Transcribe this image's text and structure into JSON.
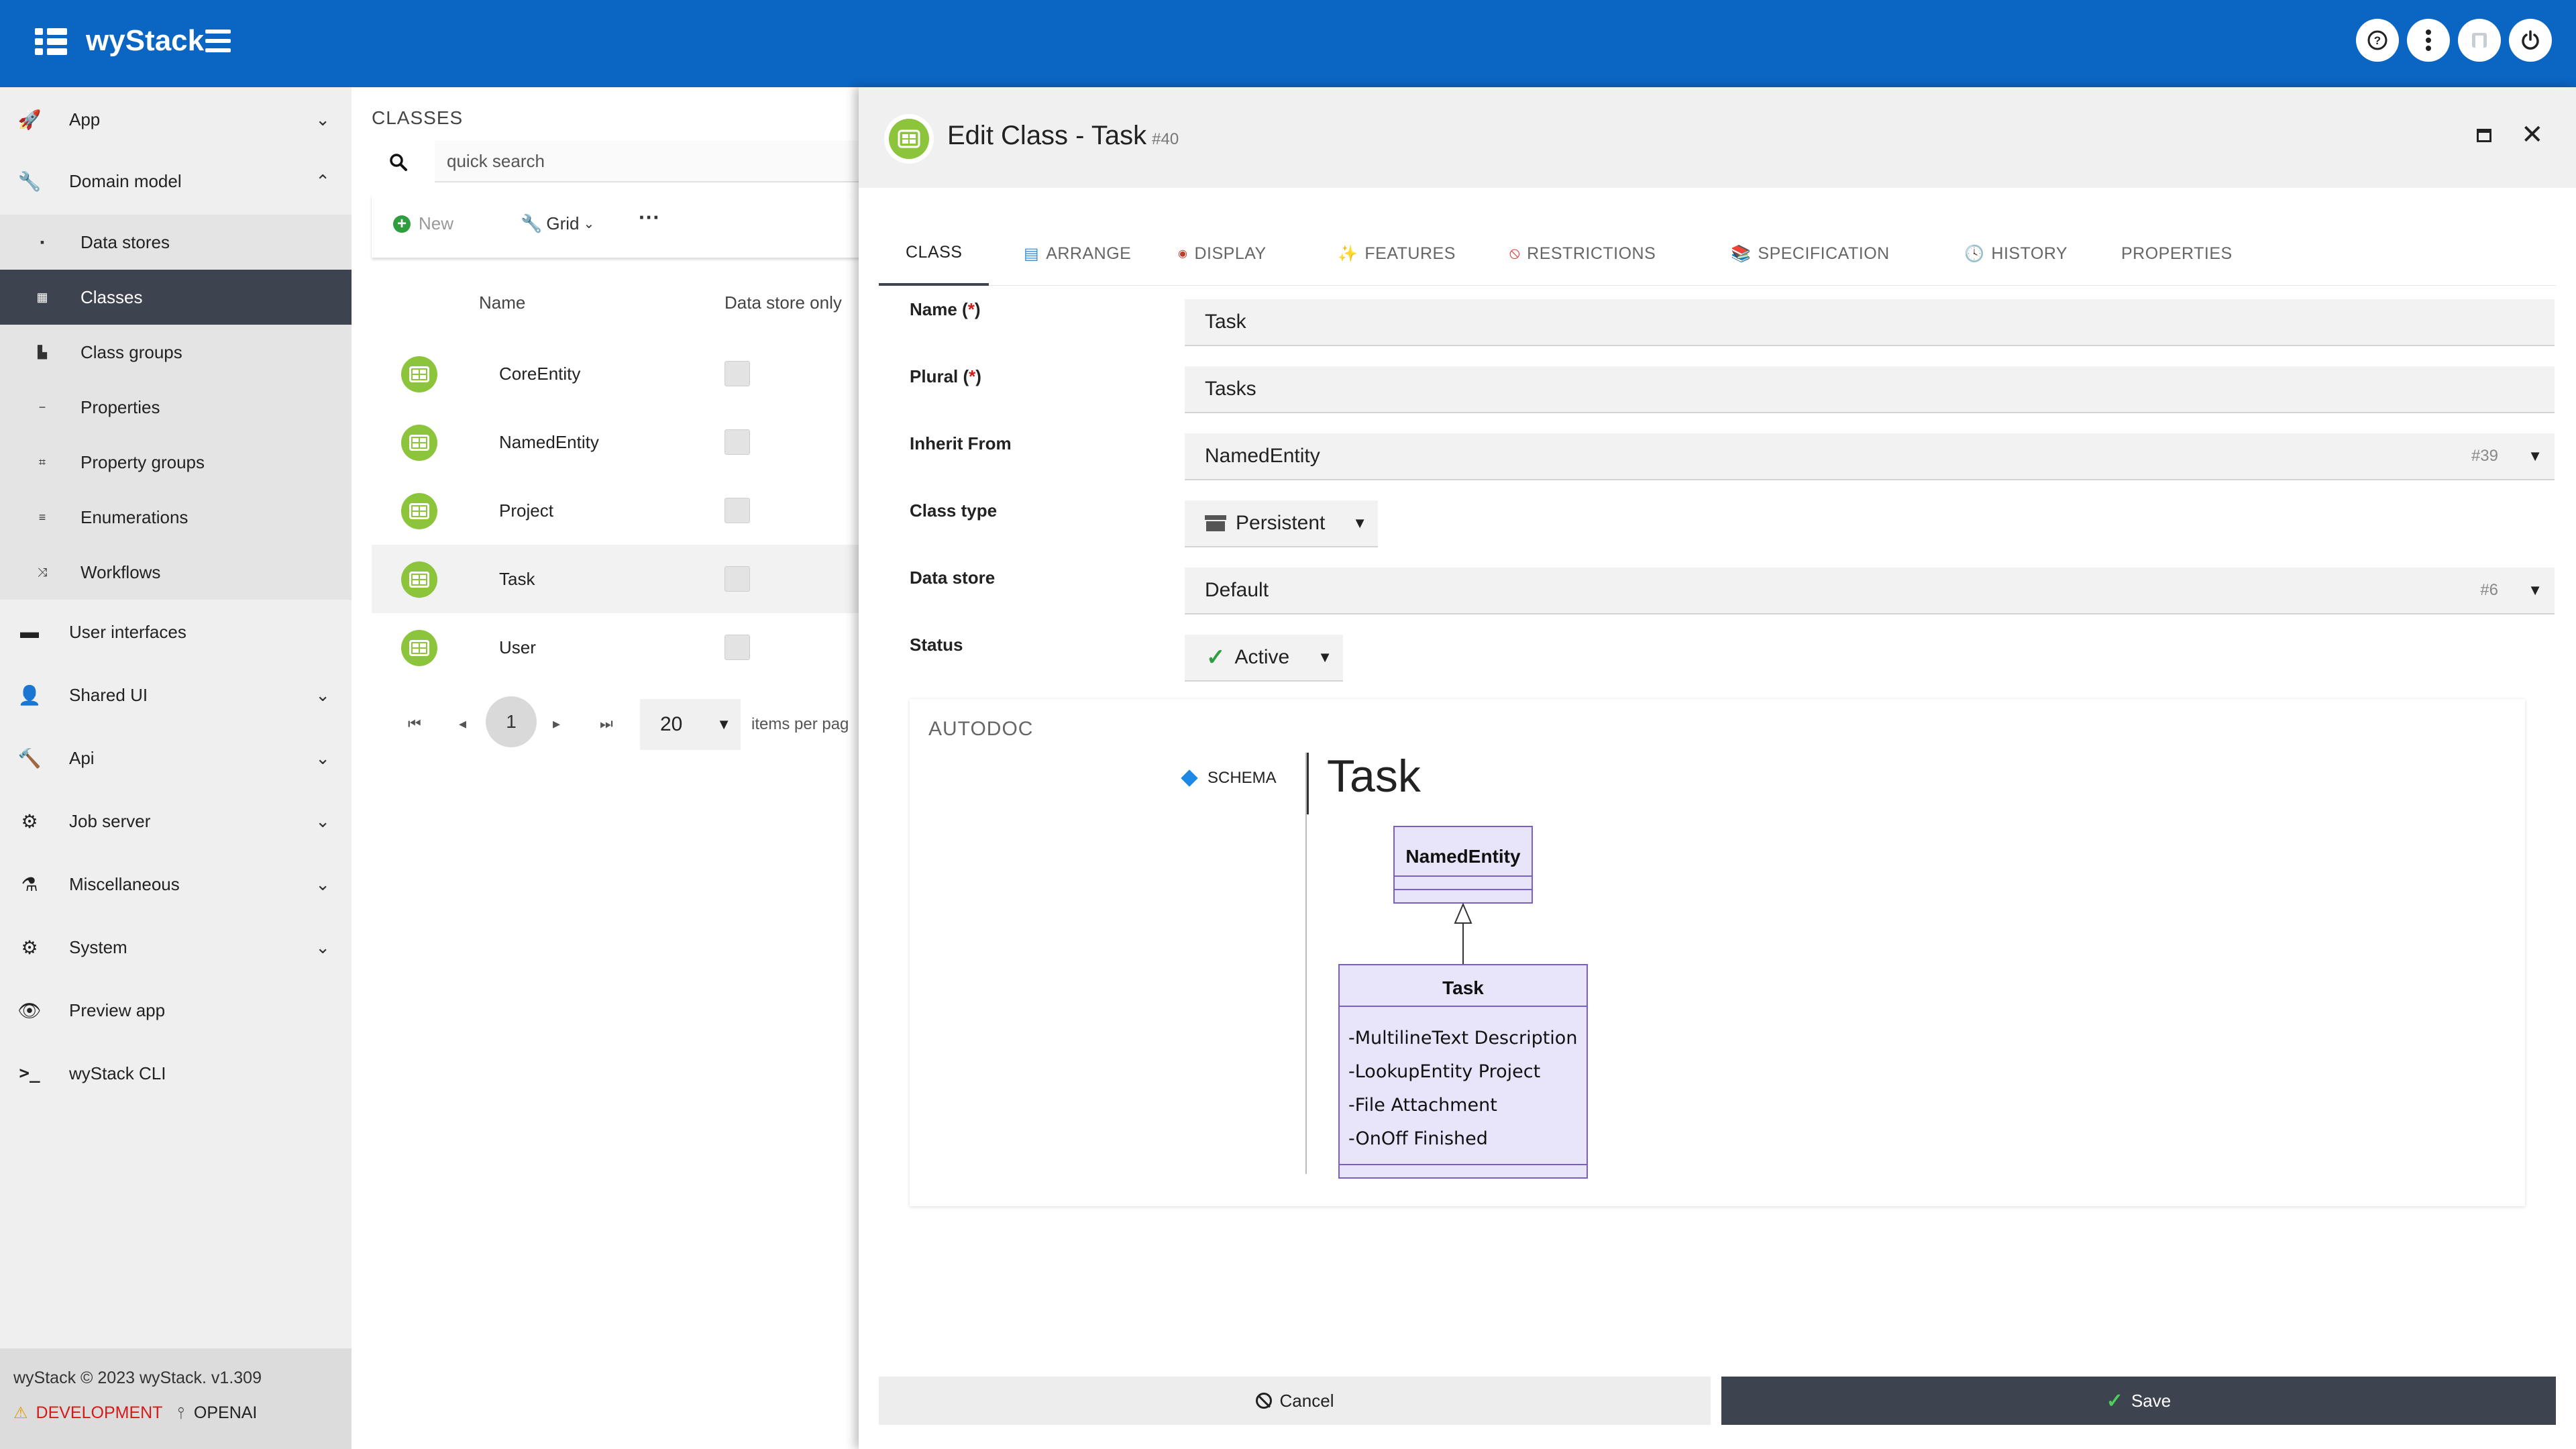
{
  "app": {
    "brand": "wyStack"
  },
  "topbar": {
    "buttons": [
      "help-icon",
      "more-vert-icon",
      "user-icon",
      "power-icon"
    ]
  },
  "sidebar": {
    "items": [
      {
        "label": "App",
        "icon": "rocket-icon",
        "expanded": false
      },
      {
        "label": "Domain model",
        "icon": "wrench-icon",
        "expanded": true
      },
      {
        "label": "User interfaces",
        "icon": "window-icon"
      },
      {
        "label": "Shared UI",
        "icon": "person-icon",
        "expanded": false
      },
      {
        "label": "Api",
        "icon": "hammer-icon",
        "expanded": false
      },
      {
        "label": "Job server",
        "icon": "gear-icon",
        "expanded": false
      },
      {
        "label": "Miscellaneous",
        "icon": "flask-icon",
        "expanded": false
      },
      {
        "label": "System",
        "icon": "gears-icon",
        "expanded": false
      },
      {
        "label": "Preview app",
        "icon": "eye-icon"
      },
      {
        "label": "wyStack CLI",
        "icon": "terminal-icon"
      }
    ],
    "sub_items": [
      {
        "label": "Data stores"
      },
      {
        "label": "Classes",
        "active": true
      },
      {
        "label": "Class groups"
      },
      {
        "label": "Properties"
      },
      {
        "label": "Property groups"
      },
      {
        "label": "Enumerations"
      },
      {
        "label": "Workflows"
      }
    ],
    "footer": {
      "copyright": "wyStack © 2023 wyStack. v1.309",
      "env": "DEVELOPMENT",
      "ai": "OPENAI"
    }
  },
  "list": {
    "title": "CLASSES",
    "search_placeholder": "quick search",
    "toolbar": {
      "new_label": "New",
      "grid_label": "Grid",
      "more_label": "···"
    },
    "columns": [
      "Name",
      "Data store only"
    ],
    "rows": [
      {
        "name": "CoreEntity"
      },
      {
        "name": "NamedEntity"
      },
      {
        "name": "Project"
      },
      {
        "name": "Task",
        "selected": true
      },
      {
        "name": "User"
      }
    ],
    "pager": {
      "page": "1",
      "per_page": "20",
      "per_page_label": "items per pag"
    }
  },
  "dialog": {
    "title": "Edit Class - Task",
    "id": "#40",
    "tabs": [
      {
        "label": "CLASS",
        "active": true
      },
      {
        "label": "ARRANGE",
        "icon": "arrange-icon"
      },
      {
        "label": "DISPLAY",
        "icon": "display-icon"
      },
      {
        "label": "FEATURES",
        "icon": "sparkle-icon"
      },
      {
        "label": "RESTRICTIONS",
        "icon": "ban-icon"
      },
      {
        "label": "SPECIFICATION",
        "icon": "books-icon"
      },
      {
        "label": "HISTORY",
        "icon": "clock-icon"
      },
      {
        "label": "PROPERTIES"
      }
    ],
    "form": {
      "name_label": "Name (",
      "name_req": "*",
      "name_close": ")",
      "name_value": "Task",
      "plural_label": "Plural (",
      "plural_req": "*",
      "plural_close": ")",
      "plural_value": "Tasks",
      "inherit_label": "Inherit From",
      "inherit_value": "NamedEntity",
      "inherit_id": "#39",
      "class_type_label": "Class type",
      "class_type_value": "Persistent",
      "data_store_label": "Data store",
      "data_store_value": "Default",
      "data_store_id": "#6",
      "status_label": "Status",
      "status_value": "Active"
    },
    "autodoc": {
      "title": "AUTODOC",
      "nav_label": "SCHEMA",
      "heading": "Task",
      "uml": {
        "parent": "NamedEntity",
        "child": "Task",
        "attributes": [
          "-MultilineText Description",
          "-LookupEntity Project",
          "-File Attachment",
          "-OnOff Finished"
        ]
      }
    },
    "footer": {
      "cancel_label": "Cancel",
      "save_label": "Save"
    }
  }
}
